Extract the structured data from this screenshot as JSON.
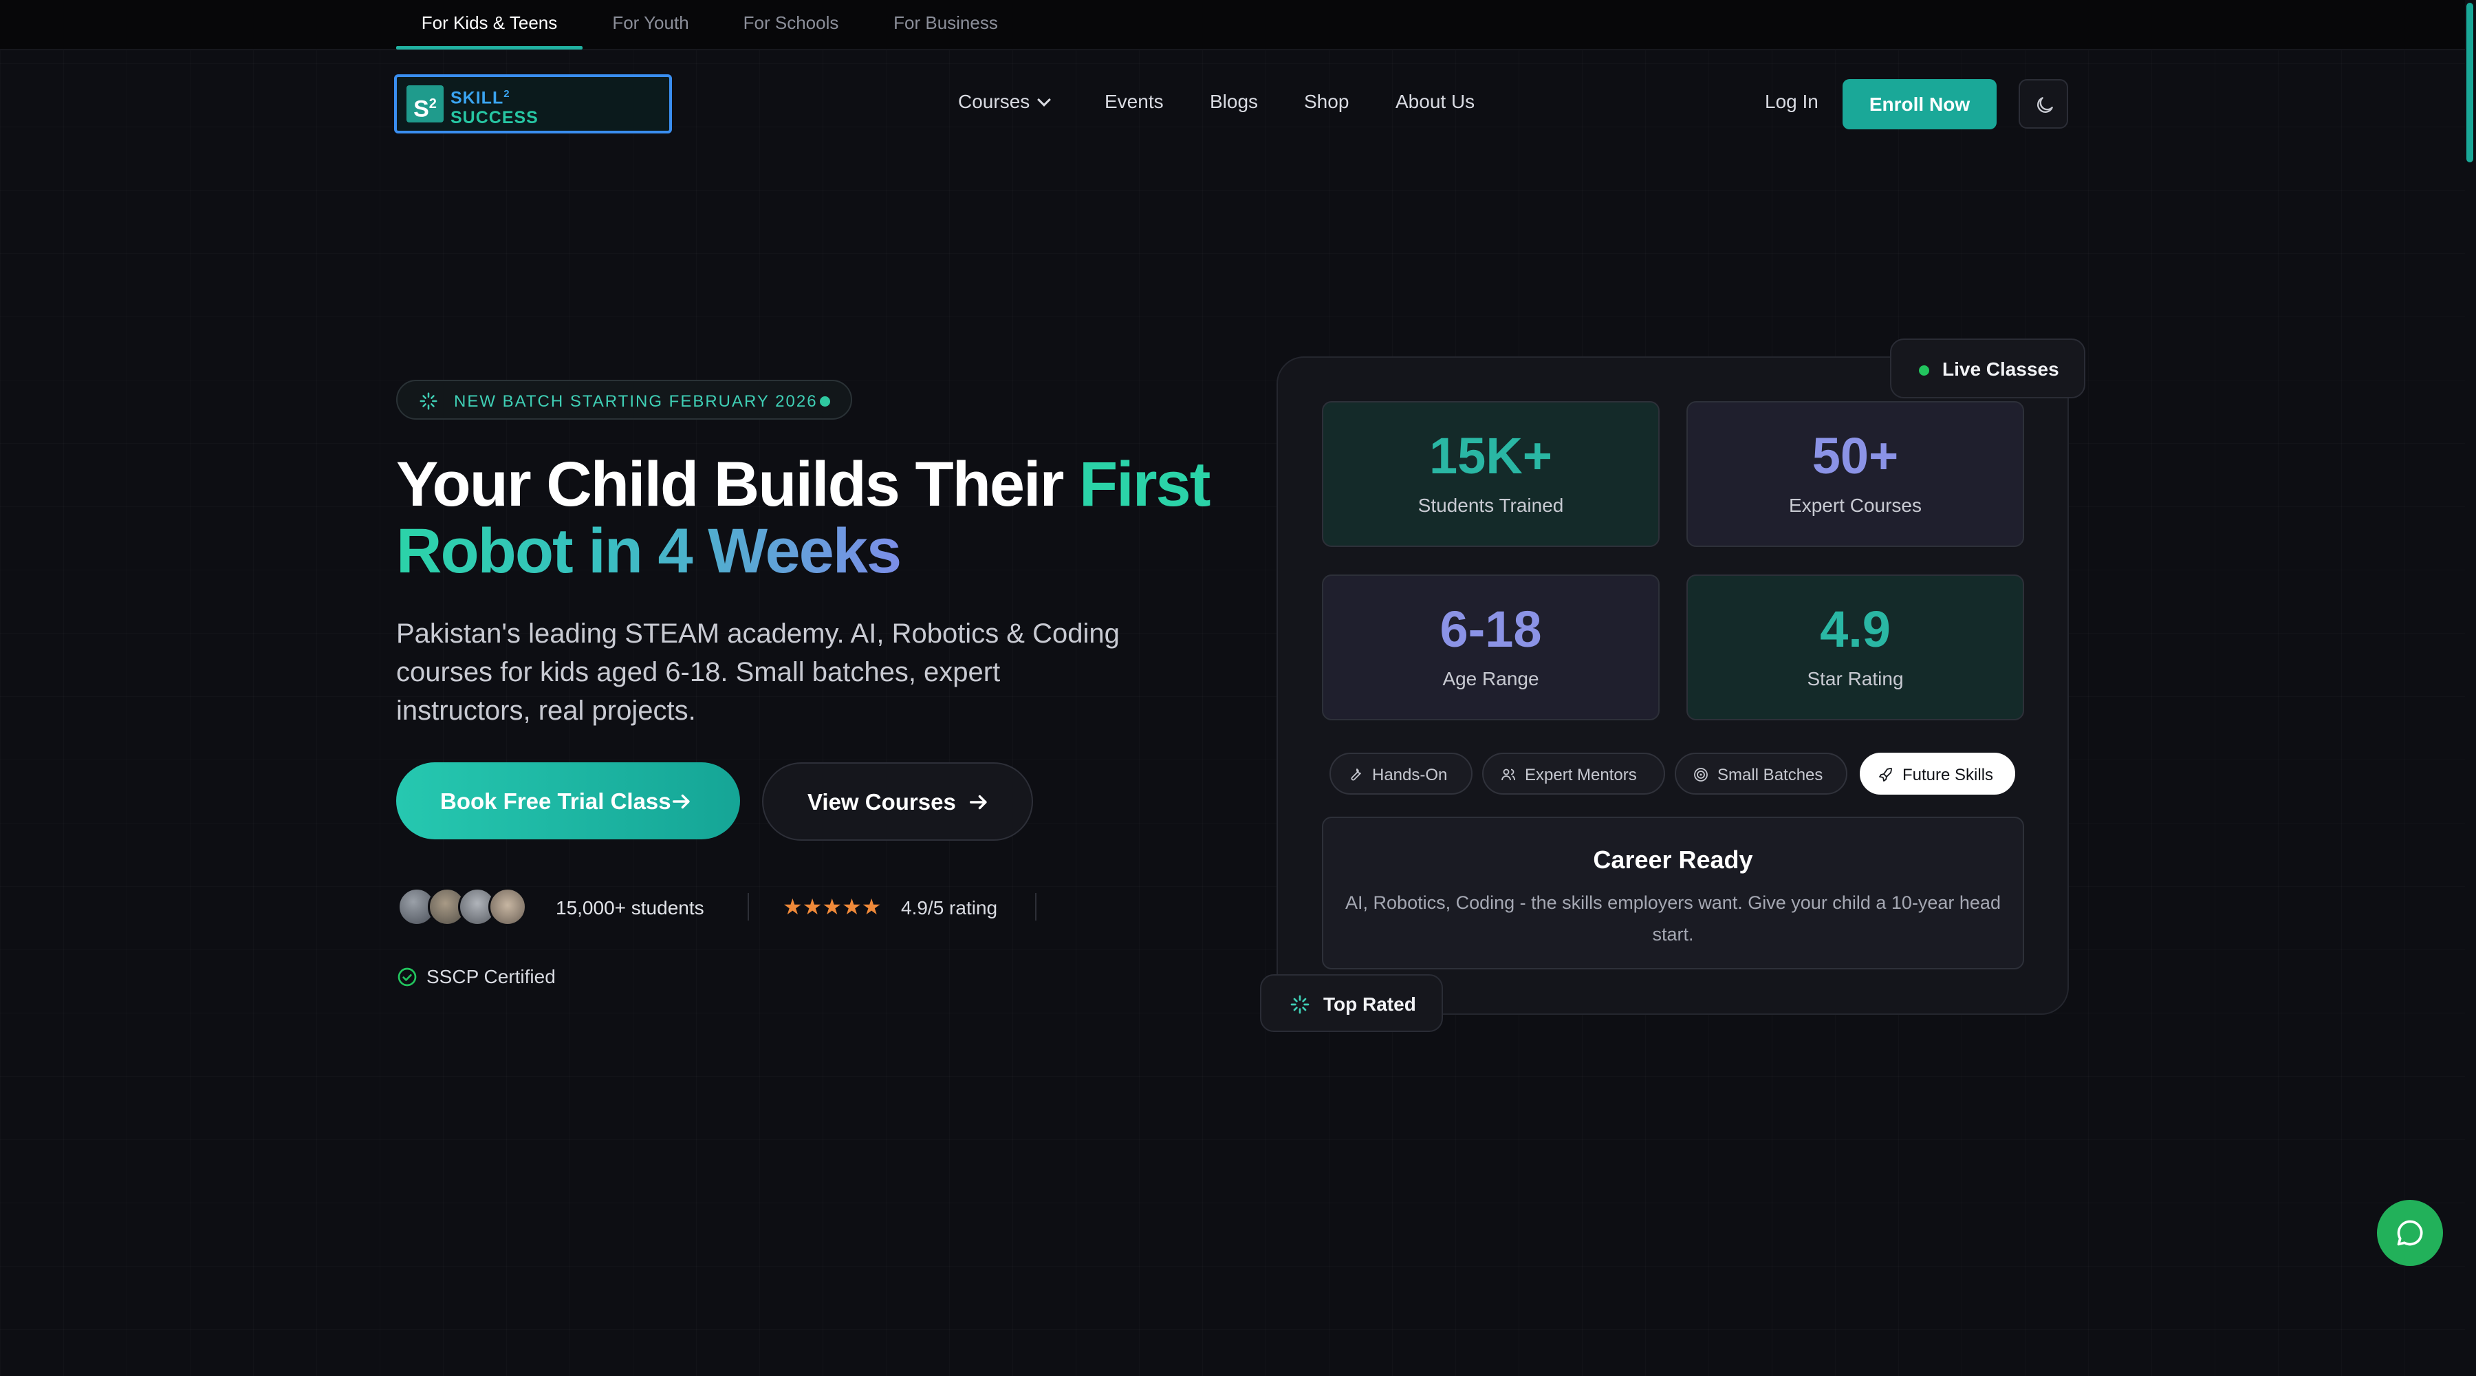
{
  "audience_tabs": [
    {
      "label": "For Kids & Teens",
      "active": true
    },
    {
      "label": "For Youth",
      "active": false
    },
    {
      "label": "For Schools",
      "active": false
    },
    {
      "label": "For Business",
      "active": false
    }
  ],
  "logo": {
    "mark": "S",
    "mark_sup": "2",
    "line1": "SKILL",
    "line1_sup": "2",
    "line2": "SUCCESS"
  },
  "nav": {
    "items": [
      {
        "label": "Courses",
        "has_dropdown": true
      },
      {
        "label": "Events"
      },
      {
        "label": "Blogs"
      },
      {
        "label": "Shop"
      },
      {
        "label": "About Us"
      }
    ],
    "login": "Log In",
    "enroll": "Enroll Now",
    "theme_icon": "moon-icon"
  },
  "hero": {
    "badge": "NEW BATCH STARTING  FEBRUARY 2026",
    "headline_white": "Your Child Builds Their ",
    "headline_green": "First",
    "headline_gradient": "Robot in 4 Weeks",
    "subtext": "Pakistan's leading STEAM academy. AI, Robotics & Coding courses for kids aged 6-18. Small batches, expert instructors, real projects.",
    "primary_cta": "Book Free Trial Class",
    "secondary_cta": "View Courses",
    "students": "15,000+ students",
    "rating": "4.9/5 rating",
    "rating_stars": 5,
    "certified": "SSCP Certified"
  },
  "stats_card": {
    "live_label": "Live Classes",
    "stats": [
      {
        "value": "15K+",
        "label": "Students Trained",
        "tone": "teal"
      },
      {
        "value": "50+",
        "label": "Expert Courses",
        "tone": "purple"
      },
      {
        "value": "6-18",
        "label": "Age Range",
        "tone": "purple"
      },
      {
        "value": "4.9",
        "label": "Star Rating",
        "tone": "teal"
      }
    ],
    "chips": [
      {
        "label": "Hands-On",
        "icon": "wrench-icon",
        "active": false
      },
      {
        "label": "Expert Mentors",
        "icon": "users-icon",
        "active": false
      },
      {
        "label": "Small Batches",
        "icon": "target-icon",
        "active": false
      },
      {
        "label": "Future Skills",
        "icon": "rocket-icon",
        "active": true
      }
    ],
    "career_title": "Career Ready",
    "career_desc": "AI, Robotics, Coding - the skills employers want. Give your child a 10-year head start.",
    "top_rated": "Top Rated"
  },
  "colors": {
    "background": "#0d0e13",
    "accent_teal": "#1aa898",
    "accent_purple": "#8b93e6",
    "chat_green": "#22b15a"
  },
  "icons": {
    "chat": "chat-bubble-icon",
    "sparkle": "sparkle-icon",
    "check": "check-circle-icon",
    "arrow": "arrow-right-icon"
  }
}
